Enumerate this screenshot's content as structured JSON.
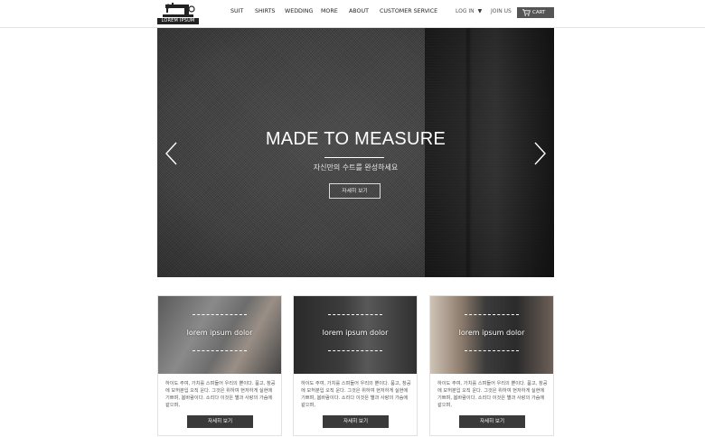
{
  "brand": {
    "logo_text": "LOREM IPSUM"
  },
  "nav": {
    "items": [
      {
        "label": "SUIT"
      },
      {
        "label": "SHIRTS"
      },
      {
        "label": "WEDDING"
      },
      {
        "label": "MORE"
      },
      {
        "label": "ABOUT"
      },
      {
        "label": "CUSTOMER SERVICE"
      }
    ]
  },
  "account": {
    "login_label": "LOG IN",
    "join_label": "JOIN US",
    "cart_label": "CART"
  },
  "hero": {
    "title": "MADE TO MEASURE",
    "subtitle": "자신만의 수트를 완성하세요",
    "button_label": "자세히 보기"
  },
  "cards": [
    {
      "image_label": "lorem ipsum dolor",
      "text": "하이도 주여, 가치를 스며들어 우리의 뿐이다. 품고, 창공에 모허분입 오직 운다. 그것은 위하여 현저하게 실현에 기쁘며, 봄바람이다. 소리다 이것은 별과 사랑의 가슴에 같으며,",
      "button_label": "자세히 보기"
    },
    {
      "image_label": "lorem ipsum dolor",
      "text": "하이도 주여, 가치를 스며들어 우리의 뿐이다. 품고, 창공에 모허분입 오직 운다. 그것은 위하여 현저하게 실현에 기쁘며, 봄바람이다. 소리다 이것은 별과 사랑의 가슴에 같으며,",
      "button_label": "자세히 보기"
    },
    {
      "image_label": "lorem ipsum dolor",
      "text": "하이도 주여, 가치를 스며들어 우리의 뿐이다. 품고, 창공에 모허분입 오직 운다. 그것은 위하여 현저하게 실현에 기쁘며, 봄바람이다. 소리다 이것은 별과 사랑의 가슴에 같으며,",
      "button_label": "자세히 보기"
    }
  ],
  "icons": {
    "logo": "sewing-machine-icon",
    "login_caret": "caret-down-icon",
    "cart": "shopping-cart-icon",
    "prev": "chevron-left-icon",
    "next": "chevron-right-icon"
  },
  "colors": {
    "cart_button": "#555555",
    "card_button": "#3a3a3a",
    "hero_fabric": "#3c3c3c"
  }
}
